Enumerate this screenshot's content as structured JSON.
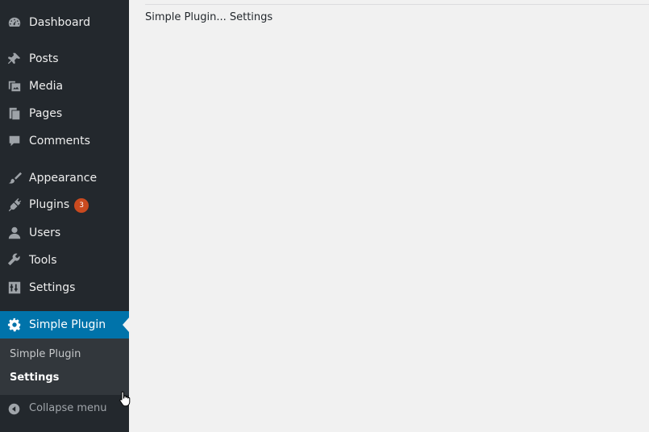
{
  "sidebar": {
    "items": [
      {
        "label": "Dashboard",
        "icon": "dashboard-icon"
      },
      {
        "label": "Posts",
        "icon": "pushpin-icon"
      },
      {
        "label": "Media",
        "icon": "media-icon"
      },
      {
        "label": "Pages",
        "icon": "pages-icon"
      },
      {
        "label": "Comments",
        "icon": "comment-icon"
      },
      {
        "label": "Appearance",
        "icon": "paintbrush-icon"
      },
      {
        "label": "Plugins",
        "icon": "plug-icon",
        "badge": "3"
      },
      {
        "label": "Users",
        "icon": "user-icon"
      },
      {
        "label": "Tools",
        "icon": "wrench-icon"
      },
      {
        "label": "Settings",
        "icon": "sliders-icon"
      },
      {
        "label": "Simple Plugin",
        "icon": "gear-icon"
      }
    ],
    "submenu": [
      {
        "label": "Simple Plugin"
      },
      {
        "label": "Settings"
      }
    ],
    "collapse_label": "Collapse menu"
  },
  "main": {
    "page_text": "Simple Plugin... Settings"
  },
  "colors": {
    "sidebar_bg": "#23282d",
    "submenu_bg": "#32373c",
    "accent": "#0073aa",
    "badge": "#ca4a1f",
    "page_bg": "#f1f1f1"
  }
}
